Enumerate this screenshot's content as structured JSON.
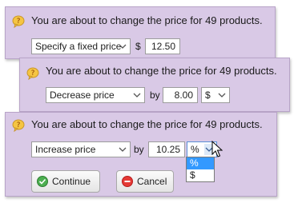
{
  "dialogs": [
    {
      "message": "You are about to change the price for 49 products.",
      "mode_select": "Specify a fixed price",
      "currency_label": "$",
      "amount": "12.50"
    },
    {
      "message": "You are about to change the price for 49 products.",
      "mode_select": "Decrease price",
      "by_label": "by",
      "amount": "8.00",
      "unit_select": "$"
    },
    {
      "message": "You are about to change the price for 49 products.",
      "mode_select": "Increase price",
      "by_label": "by",
      "amount": "10.25",
      "unit_select": "%",
      "unit_options": [
        "%",
        "$"
      ],
      "unit_selected_option": "%",
      "continue_label": "Continue",
      "cancel_label": "Cancel"
    }
  ],
  "colors": {
    "panel_background": "#d9c9e6",
    "panel_border": "#b8a4c8",
    "selected_option": "#3399ff",
    "bubble_icon": "#f5c542",
    "continue_icon": "#4caf50",
    "cancel_icon": "#e53935"
  },
  "icons": {
    "bubble": "question-bubble-icon",
    "continue": "check-circle-icon",
    "cancel": "minus-circle-icon",
    "dropdown": "chevron-down-icon",
    "cursor": "mouse-pointer-icon"
  }
}
